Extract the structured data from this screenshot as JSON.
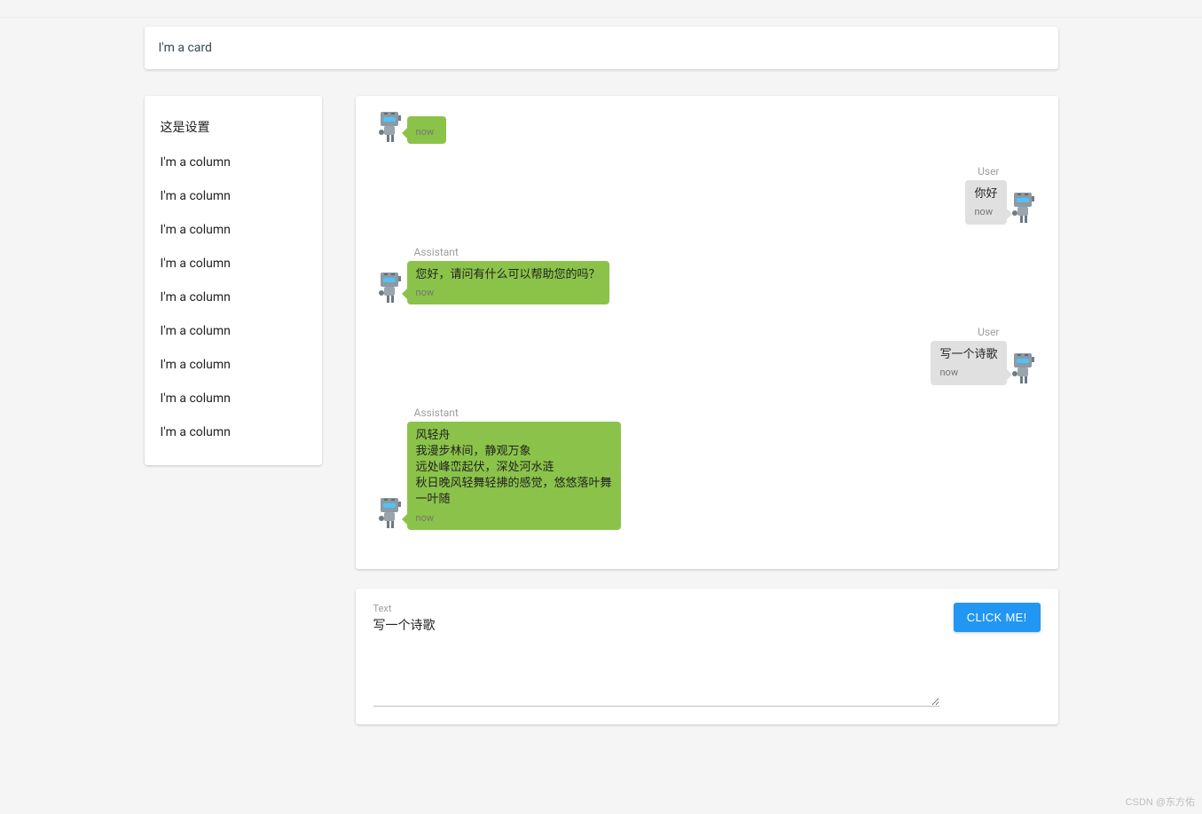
{
  "header": {
    "title": "I'm a card"
  },
  "sidebar": {
    "settings_label": "这是设置",
    "items": [
      {
        "label": "I'm a column"
      },
      {
        "label": "I'm a column"
      },
      {
        "label": "I'm a column"
      },
      {
        "label": "I'm a column"
      },
      {
        "label": "I'm a column"
      },
      {
        "label": "I'm a column"
      },
      {
        "label": "I'm a column"
      },
      {
        "label": "I'm a column"
      },
      {
        "label": "I'm a column"
      }
    ]
  },
  "chat": {
    "messages": [
      {
        "sender": "",
        "text": "",
        "stamp": "now",
        "side": "received",
        "bg": "green",
        "avatar": "robot"
      },
      {
        "sender": "User",
        "text": "你好",
        "stamp": "now",
        "side": "sent",
        "bg": "gray",
        "avatar": "robot"
      },
      {
        "sender": "Assistant",
        "text": "您好，请问有什么可以帮助您的吗？",
        "stamp": "now",
        "side": "received",
        "bg": "green",
        "avatar": "robot"
      },
      {
        "sender": "User",
        "text": "写一个诗歌",
        "stamp": "now",
        "side": "sent",
        "bg": "gray",
        "avatar": "robot"
      },
      {
        "sender": "Assistant",
        "text": "风轻舟\n我漫步林间，静观万象\n远处峰峦起伏，深处河水涟\n秋日晚风轻舞轻拂的感觉，悠悠落叶舞\n一叶随",
        "stamp": "now",
        "side": "received",
        "bg": "green",
        "avatar": "robot"
      }
    ]
  },
  "input": {
    "label": "Text",
    "value": "写一个诗歌",
    "button_label": "CLICK ME!"
  },
  "watermark": "CSDN @东方佑",
  "colors": {
    "topbar": "#f5f5f5",
    "bubble_green": "#8bc34a",
    "bubble_gray": "#e0e0e0",
    "primary": "#2196f3"
  },
  "icons": {
    "robot_avatar": "robot-icon"
  }
}
